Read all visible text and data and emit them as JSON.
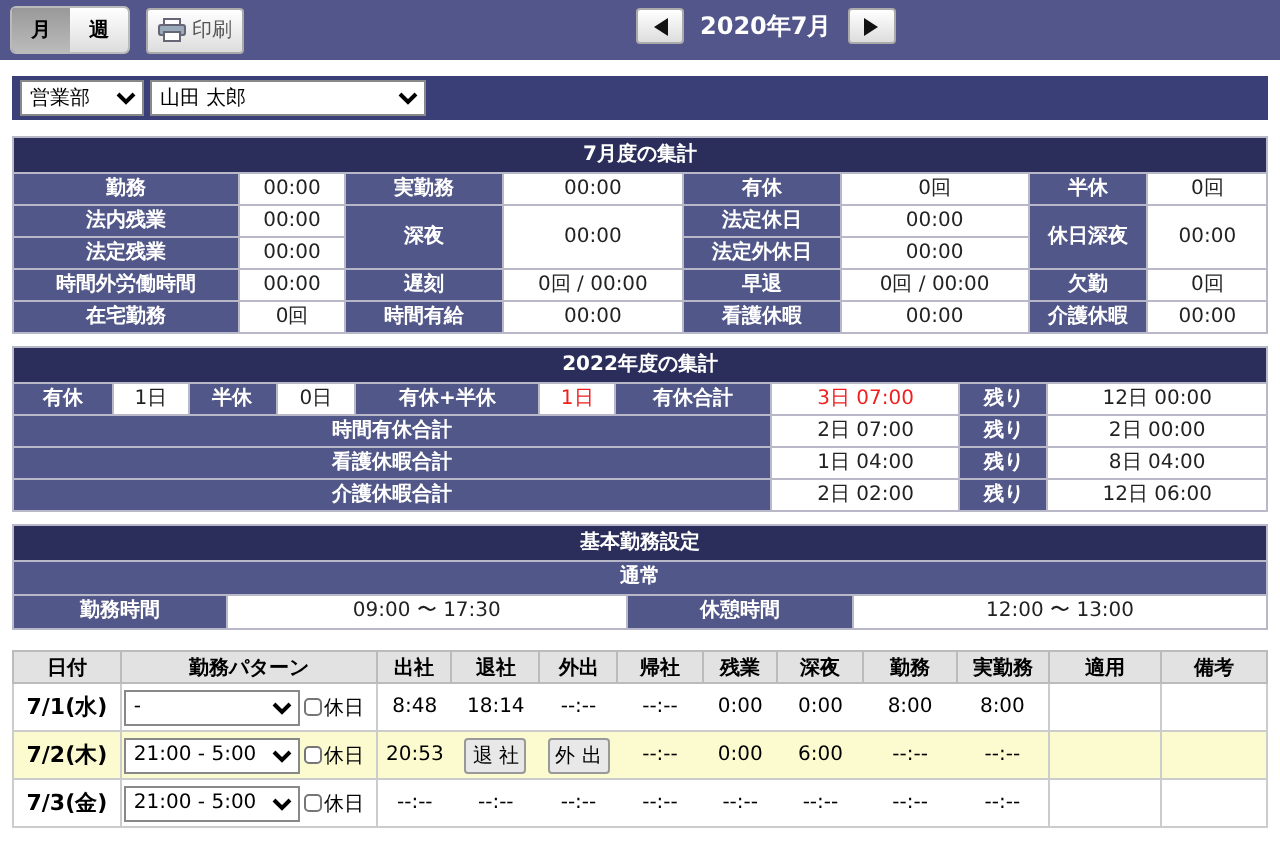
{
  "toolbar": {
    "view_tabs": [
      {
        "label": "月",
        "selected": true
      },
      {
        "label": "週",
        "selected": false
      }
    ],
    "print_button": "印刷",
    "period": "2020年7月"
  },
  "filters": {
    "department": "営業部",
    "employee": "山田 太郎"
  },
  "month_summary": {
    "title": "7月度の集計",
    "rows": [
      [
        {
          "label": "勤務",
          "value": "00:00"
        },
        {
          "label": "実勤務",
          "value": "00:00"
        },
        {
          "label": "有休",
          "value": "0回"
        },
        {
          "label": "半休",
          "value": "0回"
        }
      ],
      [
        {
          "label": "法内残業",
          "value": "00:00"
        },
        {
          "label": "深夜",
          "value": "00:00",
          "rowspan": 2
        },
        {
          "label": "法定休日",
          "value": "00:00"
        },
        {
          "label": "休日深夜",
          "value": "00:00",
          "rowspan": 2
        }
      ],
      [
        {
          "label": "法定残業",
          "value": "00:00"
        },
        {
          "label": "法定外休日",
          "value": "00:00"
        }
      ],
      [
        {
          "label": "時間外労働時間",
          "value": "00:00"
        },
        {
          "label": "遅刻",
          "value": "0回 / 00:00"
        },
        {
          "label": "早退",
          "value": "0回 / 00:00"
        },
        {
          "label": "欠勤",
          "value": "0回"
        }
      ],
      [
        {
          "label": "在宅勤務",
          "value": "0回"
        },
        {
          "label": "時間有給",
          "value": "00:00"
        },
        {
          "label": "看護休暇",
          "value": "00:00"
        },
        {
          "label": "介護休暇",
          "value": "00:00"
        }
      ]
    ]
  },
  "year_summary": {
    "title": "2022年度の集計",
    "first_row": [
      {
        "label": "有休",
        "value": "1日",
        "alert": false
      },
      {
        "label": "半休",
        "value": "0日",
        "alert": false
      },
      {
        "label": "有休+半休",
        "value": "1日",
        "alert": true
      },
      {
        "label": "有休合計",
        "value": "3日 07:00",
        "alert": true
      }
    ],
    "first_remaining": {
      "label": "残り",
      "value": "12日 00:00"
    },
    "rows": [
      {
        "label": "時間有休合計",
        "value": "2日 07:00",
        "remaining_label": "残り",
        "remaining": "2日 00:00"
      },
      {
        "label": "看護休暇合計",
        "value": "1日 04:00",
        "remaining_label": "残り",
        "remaining": "8日 04:00"
      },
      {
        "label": "介護休暇合計",
        "value": "2日 02:00",
        "remaining_label": "残り",
        "remaining": "12日 06:00"
      }
    ]
  },
  "basic_settings": {
    "title": "基本勤務設定",
    "pattern": "通常",
    "items": [
      {
        "label": "勤務時間",
        "value": "09:00 〜 17:30"
      },
      {
        "label": "休憩時間",
        "value": "12:00 〜 13:00"
      }
    ]
  },
  "daily_table": {
    "columns": [
      "日付",
      "勤務パターン",
      "出社",
      "退社",
      "外出",
      "帰社",
      "残業",
      "深夜",
      "勤務",
      "実勤務",
      "適用",
      "備考"
    ],
    "rows": [
      {
        "highlighted": false,
        "cells": [
          {
            "kind": "date",
            "text": "7/1(水)"
          },
          {
            "kind": "pattern",
            "text": "-",
            "holiday_label": "休日",
            "holiday": false
          },
          {
            "kind": "text",
            "text": "8:48"
          },
          {
            "kind": "text",
            "text": "18:14"
          },
          {
            "kind": "text",
            "text": "--:--"
          },
          {
            "kind": "text",
            "text": "--:--"
          },
          {
            "kind": "text",
            "text": "0:00"
          },
          {
            "kind": "text",
            "text": "0:00"
          },
          {
            "kind": "text",
            "text": "8:00"
          },
          {
            "kind": "text",
            "text": "8:00"
          }
        ]
      },
      {
        "highlighted": true,
        "cells": [
          {
            "kind": "date",
            "text": "7/2(木)"
          },
          {
            "kind": "pattern",
            "text": "21:00 - 5:00",
            "holiday_label": "休日",
            "holiday": false
          },
          {
            "kind": "text",
            "text": "20:53"
          },
          {
            "kind": "button",
            "text": "退 社"
          },
          {
            "kind": "button",
            "text": "外 出"
          },
          {
            "kind": "text",
            "text": "--:--"
          },
          {
            "kind": "text",
            "text": "0:00"
          },
          {
            "kind": "text",
            "text": "6:00"
          },
          {
            "kind": "text",
            "text": "--:--"
          },
          {
            "kind": "text",
            "text": "--:--"
          }
        ]
      },
      {
        "highlighted": false,
        "cells": [
          {
            "kind": "date",
            "text": "7/3(金)"
          },
          {
            "kind": "pattern",
            "text": "21:00 - 5:00",
            "holiday_label": "休日",
            "holiday": false
          },
          {
            "kind": "text",
            "text": "--:--"
          },
          {
            "kind": "text",
            "text": "--:--"
          },
          {
            "kind": "text",
            "text": "--:--"
          },
          {
            "kind": "text",
            "text": "--:--"
          },
          {
            "kind": "text",
            "text": "--:--"
          },
          {
            "kind": "text",
            "text": "--:--"
          },
          {
            "kind": "text",
            "text": "--:--"
          },
          {
            "kind": "text",
            "text": "--:--"
          }
        ]
      }
    ]
  }
}
